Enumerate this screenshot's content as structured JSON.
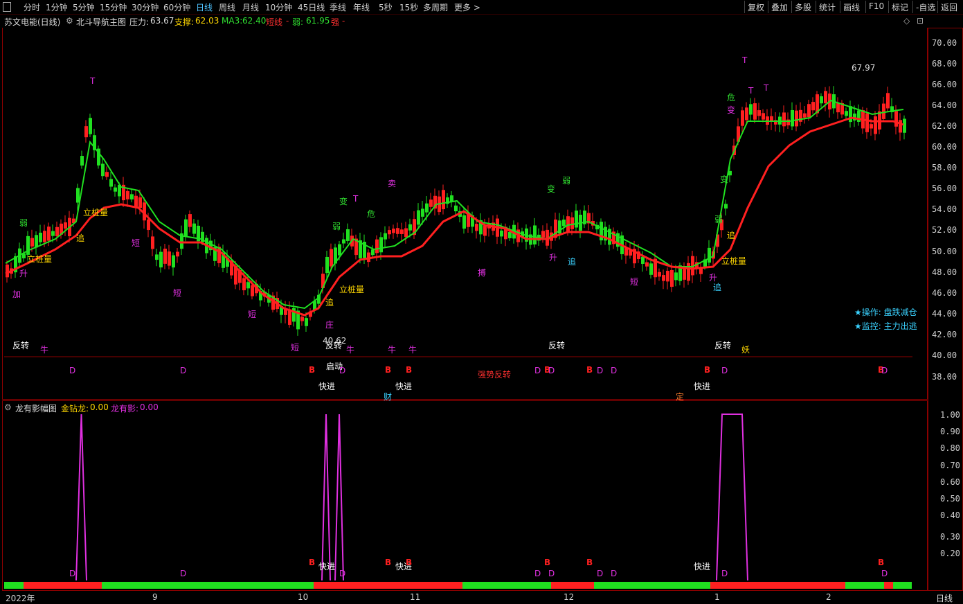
{
  "toolbar": {
    "periods": [
      "分时",
      "1分钟",
      "5分钟",
      "15分钟",
      "30分钟",
      "60分钟",
      "日线",
      "周线",
      "月线",
      "10分钟",
      "45日线",
      "季线",
      "年线",
      "5秒",
      "15秒",
      "多周期",
      "更多 >"
    ],
    "active_period": "日线",
    "right_buttons": [
      "复权",
      "叠加",
      "多股",
      "统计",
      "画线",
      "F10",
      "标记",
      "-自选",
      "返回"
    ]
  },
  "main_header": {
    "stock": "苏文电能(日线)",
    "indicator": "北斗导航主图",
    "pressure_label": "压力:",
    "pressure_value": "63.67",
    "support_label": "支撑:",
    "support_value": "62.03",
    "ma3_label": "MA3:",
    "ma3_value": "62.40",
    "short_label": "短线",
    "weak_label": "弱:",
    "weak_value": "61.95",
    "strong_label": "强"
  },
  "sub_header": {
    "indicator": "龙有影幅图",
    "gold_label": "金钻龙:",
    "gold_value": "0.00",
    "shadow_label": "龙有影:",
    "shadow_value": "0.00"
  },
  "price_axis": [
    "70.00",
    "68.00",
    "66.00",
    "64.00",
    "62.00",
    "60.00",
    "58.00",
    "56.00",
    "54.00",
    "52.00",
    "50.00",
    "48.00",
    "46.00",
    "44.00",
    "42.00",
    "40.00",
    "38.00"
  ],
  "sub_axis": [
    "1.00",
    "0.90",
    "0.80",
    "0.70",
    "0.60",
    "0.50",
    "0.40",
    "0.30",
    "0.20"
  ],
  "date_axis": [
    "2022年",
    "9",
    "10",
    "11",
    "12",
    "1",
    "2"
  ],
  "period_footer": "日线",
  "high_mark": "67.97",
  "low_mark": "40.62",
  "operation": "★操作: 盘跌减仓",
  "monitor": "★监控: 主力出逃",
  "signals": {
    "reverse": "反转",
    "start": "启动",
    "fast_in": "快进",
    "strong_reverse": "强势反转",
    "cai": "财",
    "ding": "定",
    "niu": "牛",
    "yao": "妖",
    "li_zhuang": "立桩量",
    "zhui": "追",
    "duan": "短",
    "sheng": "升",
    "ruo": "弱",
    "bian": "变",
    "wei": "危",
    "mai": "卖",
    "bo": "搏",
    "zhuang": "庄",
    "jia": "加",
    "T": "T",
    "B": "B",
    "D": "D"
  },
  "colors": {
    "up": "#ff2020",
    "down": "#20e020",
    "frame": "#8b0000",
    "magenta": "#e030e0",
    "cyan": "#3ad2ff",
    "yellow": "#ffd700"
  }
}
